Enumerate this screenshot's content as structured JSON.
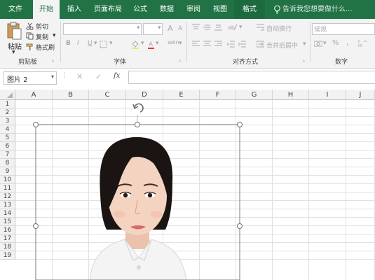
{
  "tabs": [
    "文件",
    "开始",
    "插入",
    "页面布局",
    "公式",
    "数据",
    "审阅",
    "视图",
    "格式"
  ],
  "active_tab": "开始",
  "tell_me": "告诉我您想要做什么...",
  "clipboard": {
    "paste": "粘贴",
    "cut": "剪切",
    "copy": "复制",
    "format_painter": "格式刷",
    "label": "剪贴板"
  },
  "font": {
    "bold": "B",
    "italic": "I",
    "underline": "U",
    "grow": "A",
    "shrink": "A",
    "label": "字体",
    "phonetic": "wén"
  },
  "alignment": {
    "wrap_text": "自动换行",
    "merge_center": "合并后居中",
    "label": "对齐方式"
  },
  "number": {
    "format": "常规",
    "percent": "%",
    "comma": ",",
    "label": "数字"
  },
  "name_box": "图片 2",
  "fx": "fx",
  "columns": [
    "A",
    "B",
    "C",
    "D",
    "E",
    "F",
    "G",
    "H",
    "I",
    "J"
  ],
  "rows": [
    "1",
    "2",
    "3",
    "4",
    "5",
    "6",
    "7",
    "8",
    "9",
    "10",
    "11",
    "12",
    "13",
    "14",
    "15",
    "16",
    "17",
    "18",
    "19"
  ],
  "colors": {
    "excel_green": "#217346",
    "ribbon_bg": "#f3f3f3",
    "header_bg": "#f2f2f2",
    "gridline": "#e1e1e1"
  }
}
